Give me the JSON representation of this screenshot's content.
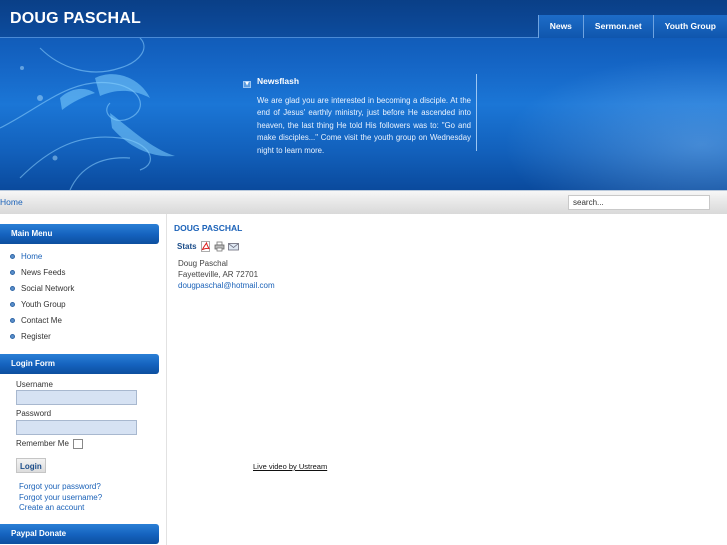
{
  "site": {
    "title": "DOUG PASCHAL"
  },
  "topnav": {
    "items": [
      {
        "label": "News"
      },
      {
        "label": "Sermon.net"
      },
      {
        "label": "Youth Group"
      }
    ]
  },
  "newsflash": {
    "title": "Newsflash",
    "text": "We are glad you are interested in becoming a disciple.  At the end of Jesus' earthly ministry, just before He ascended into heaven, the last thing He told His followers was to: \"Go and make disciples...\"  Come visit the youth group on Wednesday night to learn more."
  },
  "breadcrumb": {
    "home": "Home"
  },
  "search": {
    "placeholder": "search..."
  },
  "main_menu": {
    "title": "Main Menu",
    "items": [
      {
        "label": "Home"
      },
      {
        "label": "News Feeds"
      },
      {
        "label": "Social Network"
      },
      {
        "label": "Youth Group"
      },
      {
        "label": "Contact Me"
      },
      {
        "label": "Register"
      }
    ]
  },
  "login_form": {
    "title": "Login Form",
    "username_label": "Username",
    "password_label": "Password",
    "remember_label": "Remember Me",
    "login_button": "Login",
    "forgot_password": "Forgot your password?",
    "forgot_username": "Forgot your username?",
    "create_account": "Create an account"
  },
  "paypal": {
    "title": "Paypal Donate"
  },
  "content": {
    "heading": "DOUG PASCHAL",
    "stats_label": "Stats",
    "icons": [
      "pdf-icon",
      "print-icon",
      "email-icon"
    ],
    "contact_name": "Doug Paschal",
    "contact_location": "Fayetteville, AR 72701",
    "contact_email": "dougpaschal@hotmail.com",
    "live_video_link": "Live video by Ustream"
  },
  "colors": {
    "brand_blue": "#1461bd",
    "link_blue": "#1b62b8"
  }
}
